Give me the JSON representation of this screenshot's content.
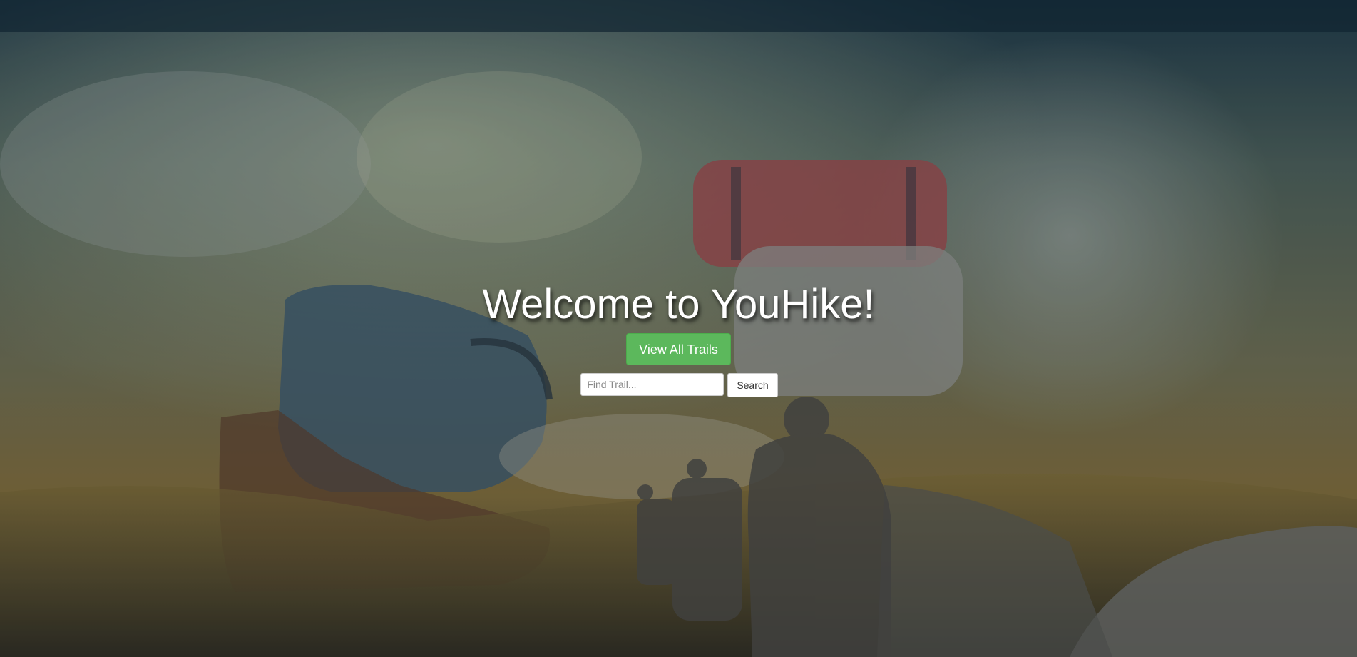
{
  "hero": {
    "title": "Welcome to YouHike!",
    "view_all_label": "View All Trails"
  },
  "search": {
    "placeholder": "Find Trail...",
    "button_label": "Search"
  },
  "background": {
    "description_icon": "hiking-photo-background",
    "accent": "#5cb85c"
  }
}
